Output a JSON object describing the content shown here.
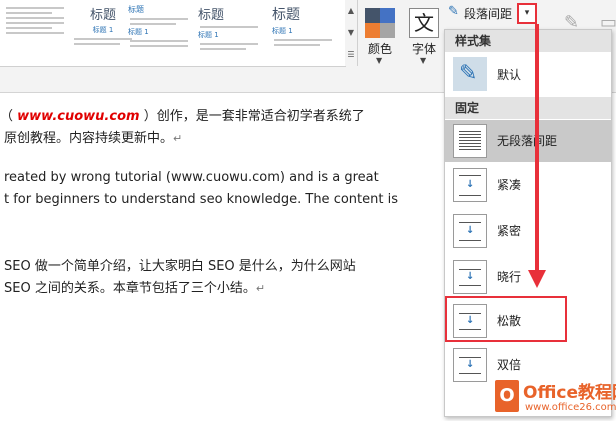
{
  "ribbon": {
    "style_gallery": [
      {
        "heading": "",
        "sub": ""
      },
      {
        "heading": "标题",
        "sub": "标题 1"
      },
      {
        "heading": "标题",
        "sub": "标题 1"
      },
      {
        "heading": "标题",
        "sub": "标题 1"
      },
      {
        "heading": "标题",
        "sub": "标题 1"
      }
    ],
    "colors_label": "颜色",
    "fonts_label": "字体",
    "font_glyph": "文",
    "paragraph_spacing_label": "段落间距",
    "dropdown_glyph": "▾"
  },
  "document": {
    "lines": [
      {
        "before": "（ ",
        "site": "www.cuowu.com",
        "after": " ）创作，是一套非常适合初学者系统了"
      },
      {
        "text": "原创教程。内容持续更新中。"
      },
      {
        "text": "reated by wrong tutorial (www.cuowu.com) and is a great"
      },
      {
        "text": "t for beginners to understand seo knowledge. The content is"
      },
      {
        "text": "SEO 做一个简单介绍，让大家明白 SEO 是什么，为什么网站"
      },
      {
        "text": "SEO 之间的关系。本章节包括了三个小结。"
      }
    ],
    "paragraph_mark": "↵"
  },
  "menu": {
    "section_style_set": "样式集",
    "default_label": "默认",
    "section_fixed": "固定",
    "items": [
      {
        "label": "无段落间距"
      },
      {
        "label": "紧凑"
      },
      {
        "label": "紧密"
      },
      {
        "label": "晓行"
      },
      {
        "label": "松散"
      },
      {
        "label": "双倍"
      }
    ]
  },
  "watermark": {
    "brand": "Office教程网",
    "url": "www.office26.com"
  },
  "colors": {
    "accent_red": "#e8303a",
    "highlight": "#c9c9c9",
    "site_link": "#e00000",
    "watermark": "#e8632a"
  }
}
